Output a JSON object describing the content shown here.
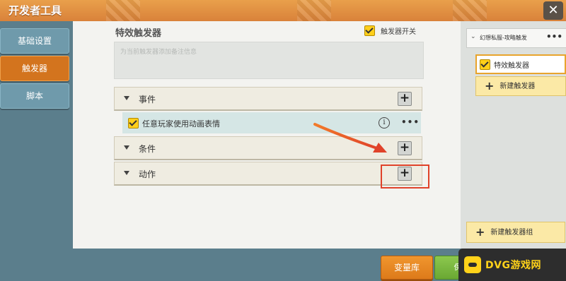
{
  "window": {
    "title": "开发者工具",
    "close_label": "✕"
  },
  "nav": {
    "items": [
      {
        "label": "基础设置"
      },
      {
        "label": "触发器"
      },
      {
        "label": "脚本"
      }
    ]
  },
  "main": {
    "title": "特效触发器",
    "enable_switch": {
      "label": "触发器开关",
      "checked": true
    },
    "description_placeholder": "为当前触发器添加备注信息",
    "sections": [
      {
        "label": "事件",
        "add_label": "+"
      },
      {
        "label": "条件",
        "add_label": "+"
      },
      {
        "label": "动作",
        "add_label": "+"
      }
    ],
    "event_item": {
      "label": "任意玩家使用动画表情",
      "checked": true,
      "info_label": "i",
      "more_label": "•••"
    }
  },
  "right_panel": {
    "group_header": "幻想私服-攻略触发",
    "group_more": "•••",
    "selected_trigger": "特效触发器",
    "new_trigger_label": "新建触发器",
    "new_group_label": "新建触发器组",
    "plus_symbol": "+"
  },
  "bottom": {
    "variable_button": "变量库",
    "green_button": "保存并返回"
  },
  "watermark": {
    "text": "DVG游戏网"
  },
  "colors": {
    "accent_orange": "#d3741e",
    "highlight_red": "#e0422a",
    "checkbox_yellow": "#ffcf1a"
  }
}
